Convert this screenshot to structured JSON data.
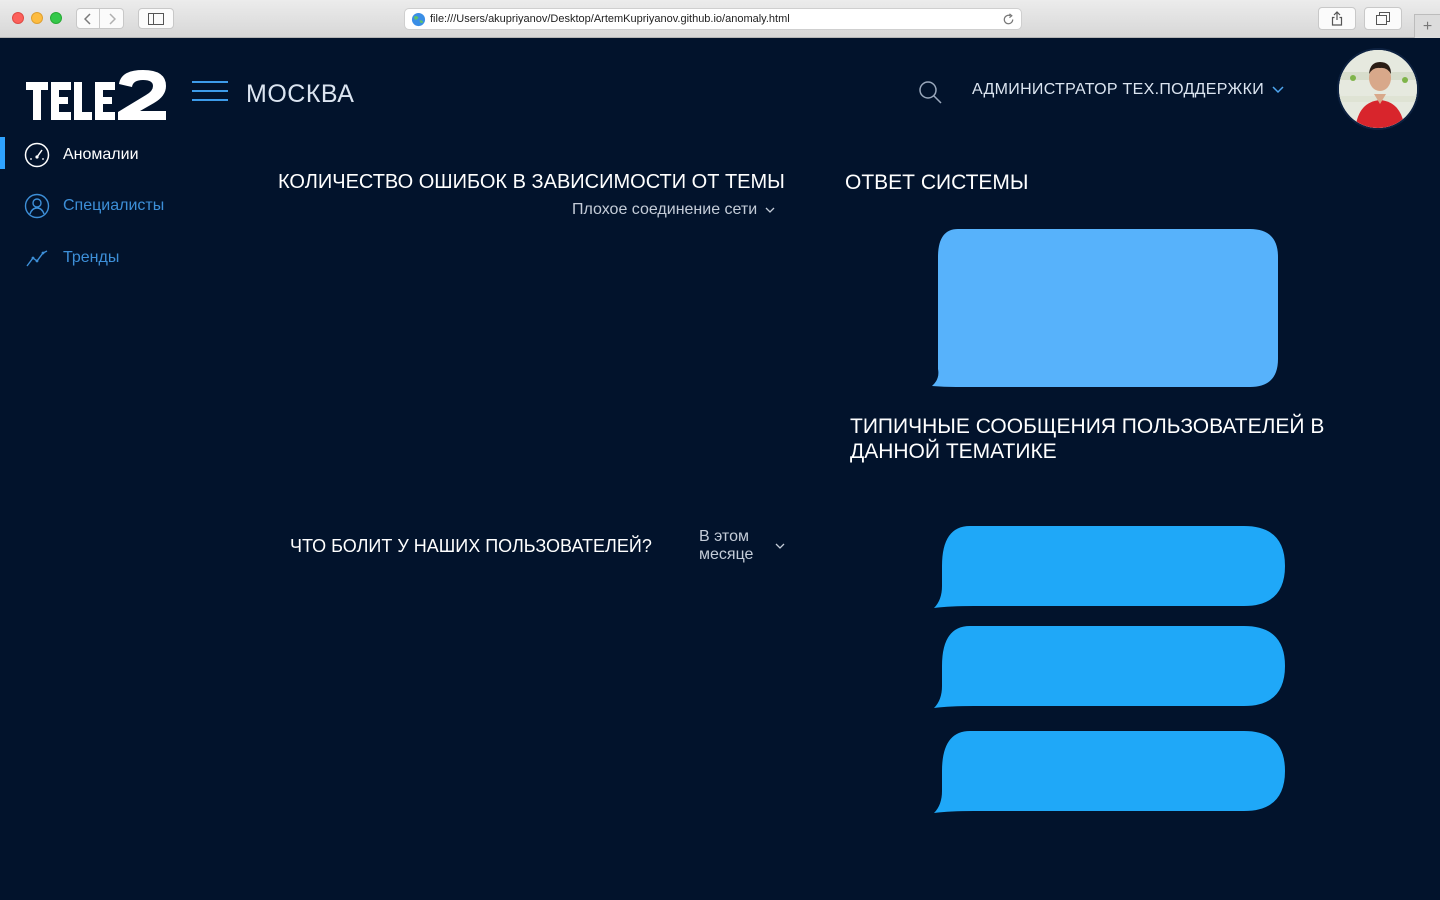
{
  "browser": {
    "url": "file:///Users/akupriyanov/Desktop/ArtemKupriyanov.github.io/anomaly.html",
    "newtab_label": "+"
  },
  "header": {
    "logo_text": "TELE2",
    "city": "МОСКВА",
    "admin_label": "АДМИНИСТРАТОР ТЕХ.ПОДДЕРЖКИ"
  },
  "sidebar": {
    "items": [
      {
        "label": "Аномалии",
        "icon": "speedometer-icon",
        "active": true
      },
      {
        "label": "Специалисты",
        "icon": "user-icon",
        "active": false
      },
      {
        "label": "Тренды",
        "icon": "trend-icon",
        "active": false
      }
    ]
  },
  "main": {
    "errors_title": "КОЛИЧЕСТВО ОШИБОК В ЗАВИСИМОСТИ ОТ ТЕМЫ",
    "topic_selected": "Плохое соединение сети",
    "answer_title": "ОТВЕТ СИСТЕМЫ",
    "typical_title": "ТИПИЧНЫЕ СООБЩЕНИЯ ПОЛЬЗОВАТЕЛЕЙ В ДАННОЙ ТЕМАТИКЕ",
    "pain_title": "ЧТО БОЛИТ У НАШИХ ПОЛЬЗОВАТЕЛЕЙ?",
    "period_selected": "В этом месяце"
  },
  "colors": {
    "background": "#02132c",
    "accent": "#2fa3ff",
    "answer_bubble": "#57b2fb",
    "message_bubble": "#1fa8f8"
  }
}
